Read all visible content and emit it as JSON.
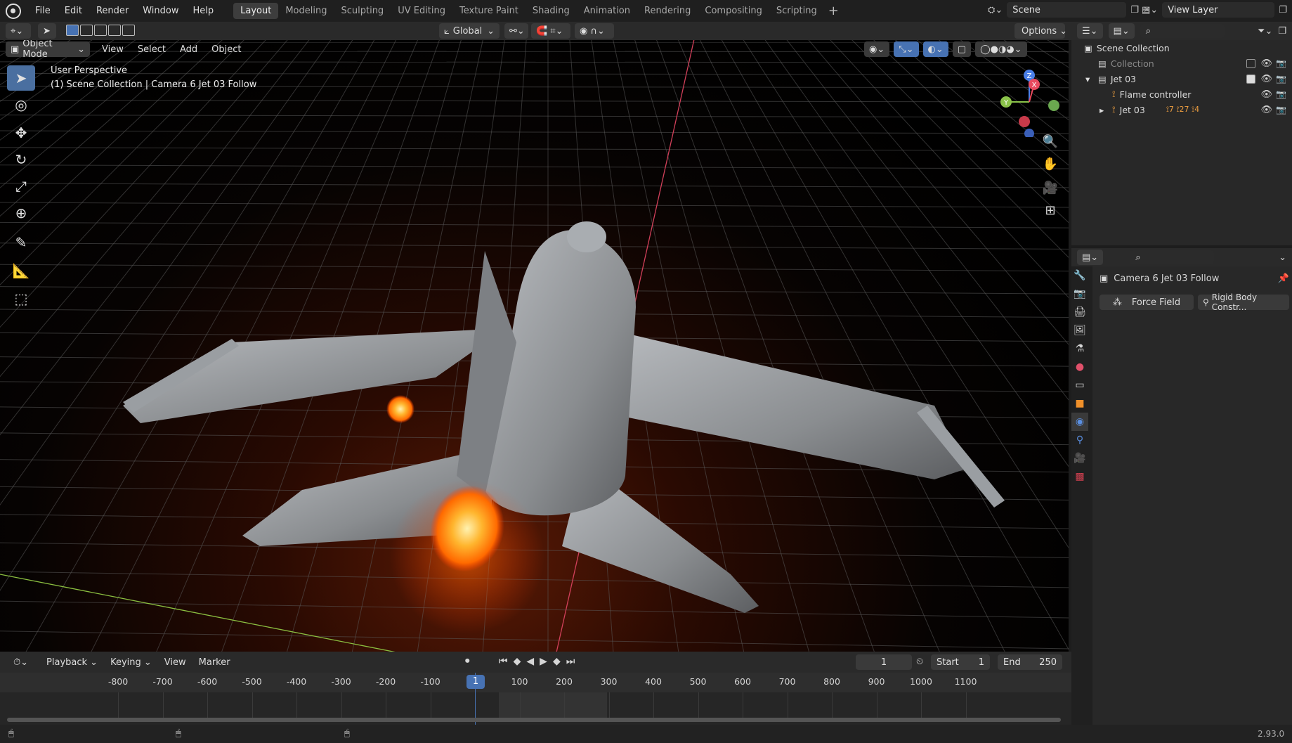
{
  "menus": [
    "File",
    "Edit",
    "Render",
    "Window",
    "Help"
  ],
  "workspaces": [
    "Layout",
    "Modeling",
    "Sculpting",
    "UV Editing",
    "Texture Paint",
    "Shading",
    "Animation",
    "Rendering",
    "Compositing",
    "Scripting"
  ],
  "scene_name": "Scene",
  "view_layer": "View Layer",
  "header": {
    "transform_orientation": "Global",
    "options_label": "Options",
    "mode": "Object Mode",
    "view_menus": [
      "View",
      "Select",
      "Add",
      "Object"
    ]
  },
  "viewport": {
    "perspective": "User Perspective",
    "active_info": "(1) Scene Collection | Camera 6 Jet 03 Follow",
    "gizmo": {
      "x": "X",
      "y": "Y",
      "z": "Z"
    }
  },
  "outliner": {
    "root": "Scene Collection",
    "items": [
      {
        "label": "Collection",
        "indent": 1,
        "dim": true
      },
      {
        "label": "Jet 03",
        "indent": 1
      },
      {
        "label": "Flame controller",
        "indent": 2
      },
      {
        "label": "Jet 03",
        "indent": 2
      }
    ],
    "badges": [
      "7",
      "27",
      "4"
    ]
  },
  "properties": {
    "object_name": "Camera 6 Jet 03 Follow",
    "buttons": [
      "Force Field",
      "Rigid Body Constr..."
    ]
  },
  "timeline": {
    "menus": [
      "Playback",
      "Keying",
      "View",
      "Marker"
    ],
    "current_frame": "1",
    "start_label": "Start",
    "start": "1",
    "end_label": "End",
    "end": "250",
    "ruler": [
      "-800",
      "-700",
      "-600",
      "-500",
      "-400",
      "-300",
      "-200",
      "-100",
      "100",
      "200",
      "300",
      "400",
      "500",
      "600",
      "700",
      "800",
      "900",
      "1000",
      "1100"
    ],
    "playhead": "1"
  },
  "version": "2.93.0",
  "colors": {
    "accent": "#4772b3",
    "selected_tool": "#4a6fa0",
    "flame": "#ff8c1a",
    "x_axis": "#e84a5f",
    "y_axis": "#8bc34a",
    "z_axis": "#4a7fe8"
  }
}
